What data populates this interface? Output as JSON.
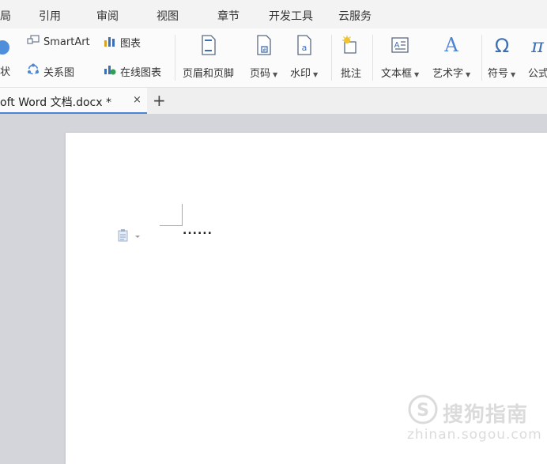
{
  "menu": {
    "tabs": [
      "局",
      "引用",
      "审阅",
      "视图",
      "章节",
      "开发工具",
      "云服务"
    ]
  },
  "ribbon": {
    "smartart_label": "SmartArt",
    "chart_label": "图表",
    "shape_label": "状",
    "relation_label": "关系图",
    "online_chart_label": "在线图表",
    "header_footer_label": "页眉和页脚",
    "page_number_label": "页码",
    "watermark_label": "水印",
    "comment_label": "批注",
    "textbox_label": "文本框",
    "wordart_label": "艺术字",
    "symbol_label": "符号",
    "formula_label": "公式"
  },
  "document_tab": {
    "title": "oft Word 文档.docx *",
    "close": "×",
    "new_tab": "+"
  },
  "document": {
    "text": "......"
  },
  "watermark": {
    "brand": "搜狗指南",
    "url": "zhinan.sogou.com"
  },
  "colors": {
    "accent": "#4a84d6",
    "icon_blue": "#3d6fb6",
    "background": "#d4d5da"
  }
}
